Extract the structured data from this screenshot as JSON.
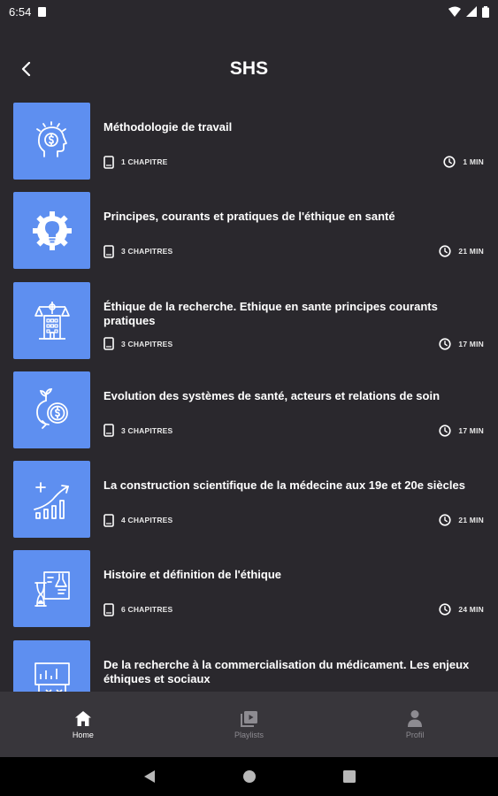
{
  "status_bar": {
    "time": "6:54"
  },
  "header": {
    "title": "SHS"
  },
  "courses": [
    {
      "title": "Méthodologie de travail",
      "chapters": "1 CHAPITRE",
      "duration": "1 MIN",
      "icon": "head-dollar-icon"
    },
    {
      "title": "Principes, courants et pratiques de l'éthique en santé",
      "chapters": "3 CHAPITRES",
      "duration": "21 MIN",
      "icon": "gear-bulb-icon"
    },
    {
      "title": "Éthique de la recherche. Ethique en sante principes courants pratiques",
      "chapters": "3 CHAPITRES",
      "duration": "17 MIN",
      "icon": "scale-building-icon"
    },
    {
      "title": "Evolution des systèmes de santé, acteurs et relations de soin",
      "chapters": "3 CHAPITRES",
      "duration": "17 MIN",
      "icon": "coins-plant-icon"
    },
    {
      "title": "La construction scientifique de la médecine aux 19e et 20e siècles",
      "chapters": "4 CHAPITRES",
      "duration": "21 MIN",
      "icon": "growth-chart-icon"
    },
    {
      "title": "Histoire et définition de l'éthique",
      "chapters": "6 CHAPITRES",
      "duration": "24 MIN",
      "icon": "hourglass-flask-icon"
    },
    {
      "title": "De la recherche à la commercialisation du médicament. Les enjeux éthiques et sociaux",
      "chapters": "",
      "duration": "",
      "icon": "presentation-board-icon"
    }
  ],
  "bottom_nav": {
    "home": "Home",
    "playlists": "Playlists",
    "profile": "Profil"
  },
  "colors": {
    "background": "#2a282d",
    "thumb": "#5e8ff0",
    "nav_bg": "#38363b"
  }
}
